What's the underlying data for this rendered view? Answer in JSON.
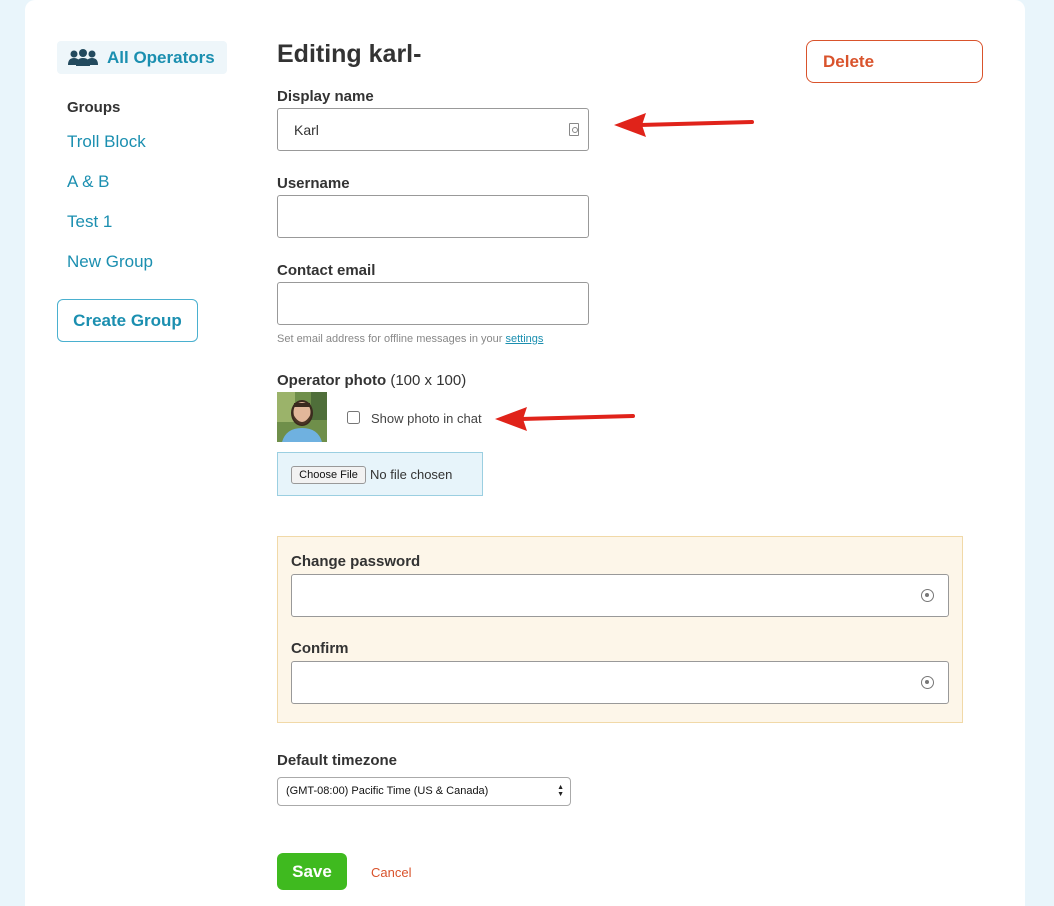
{
  "sidebar": {
    "all_operators": "All Operators",
    "groups_label": "Groups",
    "groups": [
      "Troll Block",
      "A & B",
      "Test 1",
      "New Group"
    ],
    "create_group": "Create Group"
  },
  "main": {
    "title": "Editing karl-",
    "delete_label": "Delete",
    "display_name": {
      "label": "Display name",
      "value": "Karl"
    },
    "username": {
      "label": "Username",
      "value": ""
    },
    "contact_email": {
      "label": "Contact email",
      "value": "",
      "hint": "Set email address for offline messages in your",
      "hint_link": "settings"
    },
    "photo": {
      "label": "Operator photo",
      "size_note": "(100 x 100)",
      "show_in_chat_label": "Show photo in chat",
      "show_in_chat_checked": false,
      "choose_file_label": "Choose File",
      "no_file_text": "No file chosen"
    },
    "password": {
      "change_label": "Change password",
      "confirm_label": "Confirm"
    },
    "timezone": {
      "label": "Default timezone",
      "selected": "(GMT-08:00) Pacific Time (US & Canada)"
    },
    "save_label": "Save",
    "cancel_label": "Cancel"
  },
  "colors": {
    "accent": "#1b8fb0",
    "danger": "#d9532c",
    "save": "#3fba1f",
    "annotation_arrow": "#e0231a",
    "page_bg": "#e9f5fb"
  }
}
